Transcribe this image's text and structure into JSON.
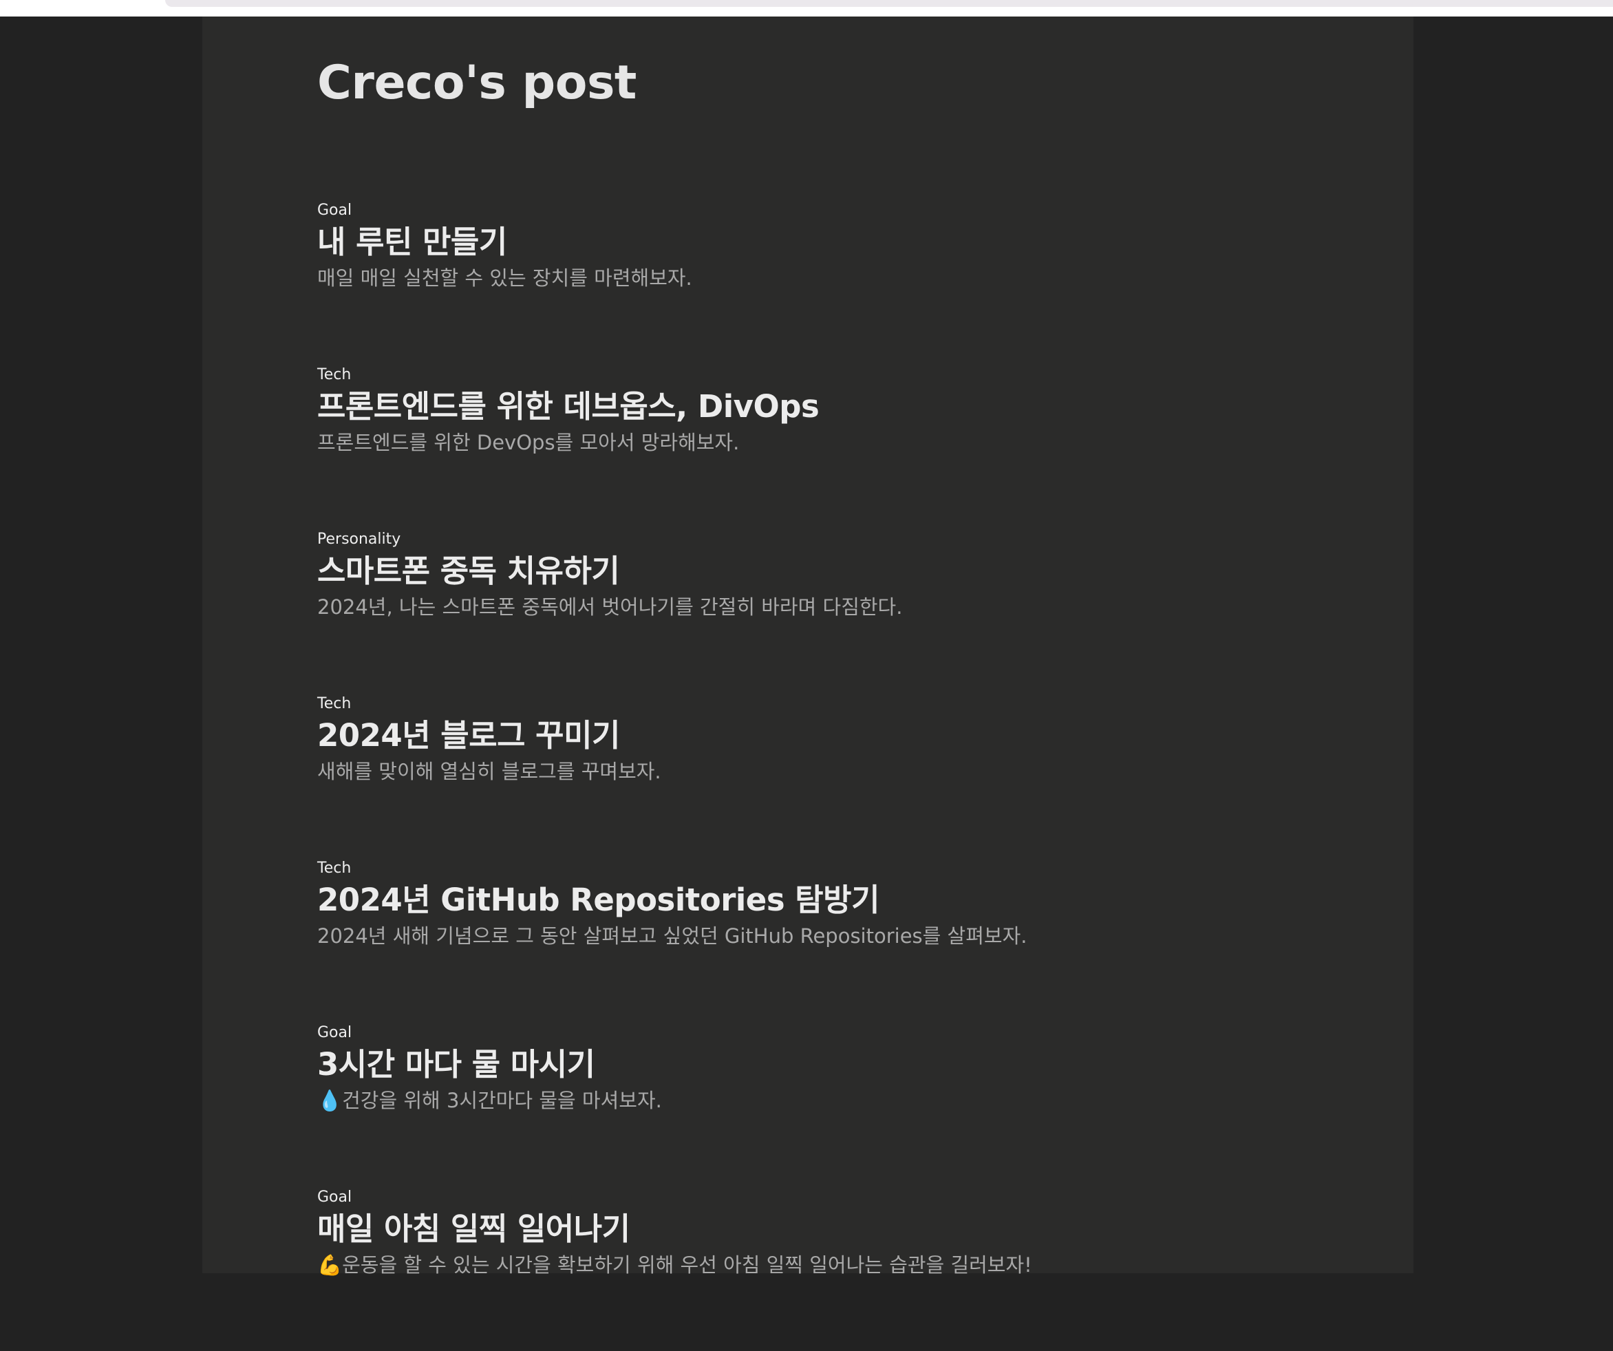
{
  "blog": {
    "title": "Creco's post"
  },
  "posts": [
    {
      "category": "Goal",
      "title": "내 루틴 만들기",
      "description": "매일 매일 실천할 수 있는 장치를 마련해보자."
    },
    {
      "category": "Tech",
      "title": "프론트엔드를 위한 데브옵스, DivOps",
      "description": "프론트엔드를 위한 DevOps를 모아서 망라해보자."
    },
    {
      "category": "Personality",
      "title": "스마트폰 중독 치유하기",
      "description": "2024년, 나는 스마트폰 중독에서 벗어나기를 간절히 바라며 다짐한다."
    },
    {
      "category": "Tech",
      "title": "2024년 블로그 꾸미기",
      "description": "새해를 맞이해 열심히 블로그를 꾸며보자."
    },
    {
      "category": "Tech",
      "title": "2024년 GitHub Repositories 탐방기",
      "description": "2024년 새해 기념으로 그 동안 살펴보고 싶었던 GitHub Repositories를 살펴보자."
    },
    {
      "category": "Goal",
      "title": "3시간 마다 물 마시기",
      "description_icon": "💧",
      "description": "건강을 위해 3시간마다 물을 마셔보자."
    },
    {
      "category": "Goal",
      "title": "매일 아침 일찍 일어나기",
      "description_icon": "💪",
      "description": "운동을 할 수 있는 시간을 확보하기 위해 우선 아침 일찍 일어나는 습관을 길러보자!"
    }
  ],
  "colors": {
    "page_background": "#222222",
    "content_background": "#2b2b2a",
    "title_text": "#e6e6e6",
    "description_text": "#a9a9a9"
  }
}
